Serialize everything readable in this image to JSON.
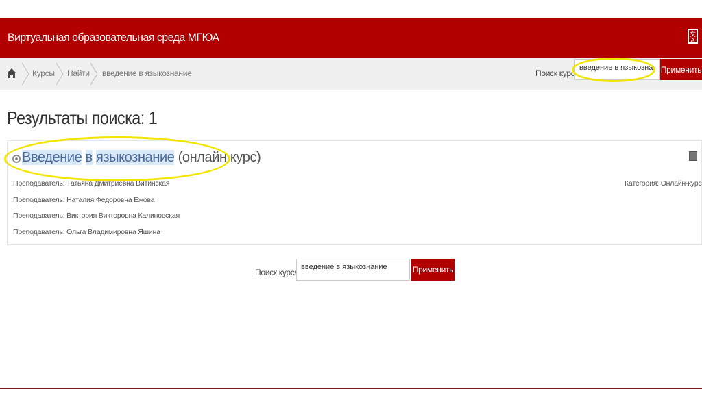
{
  "header": {
    "site_title": "Виртуальная образовательная среда МГЮА",
    "lang_icon": "language-icon"
  },
  "breadcrumb": {
    "home_icon": "home-icon",
    "items": [
      "Курсы",
      "Найти",
      "введение в языкознание"
    ]
  },
  "nav_search": {
    "label": "Поиск курса:",
    "value": "введение в языкознание",
    "button": "Применить"
  },
  "results": {
    "title": "Результаты поиска: 1"
  },
  "course": {
    "title_words": [
      "Введение",
      "в",
      "языкознание"
    ],
    "title_suffix": "(онлайн курс)",
    "teachers": [
      "Преподаватель: Татьяна Дмитриевна Витинская",
      "Преподаватель: Наталия Федоровна Ежова",
      "Преподаватель: Виктория Викторовна Калиновская",
      "Преподаватель: Ольга Владимировна Яшина"
    ],
    "category": "Категория: Онлайн-курсы"
  },
  "bottom_search": {
    "label": "Поиск курса:",
    "value": "введение в языкознание",
    "button": "Применить"
  },
  "colors": {
    "brand": "#b20000",
    "highlight": "#f2e600"
  }
}
